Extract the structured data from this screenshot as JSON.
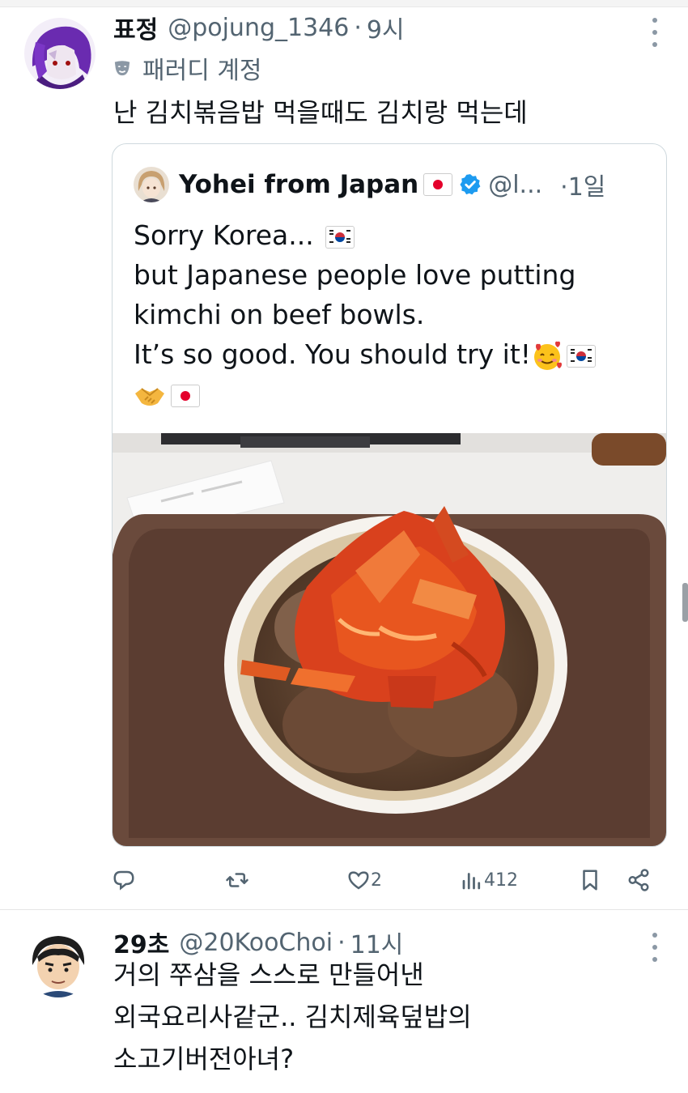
{
  "tweet1": {
    "display_name": "표정",
    "handle": "@pojung_1346",
    "sep": "·",
    "time": "9시",
    "label": "패러디 계정",
    "text": "난 김치볶음밥 먹을때도 김치랑 먹는데"
  },
  "quote": {
    "display_name": "Yohei from Japan",
    "handle": "@l...",
    "sep": "·",
    "time": "1일",
    "lines": [
      "Sorry Korea...",
      "but Japanese people love putting",
      "kimchi on beef bowls.",
      "It’s so good. You should try it!"
    ],
    "image_alt": "beef bowl topped with kimchi on a brown tray"
  },
  "actions": {
    "likes": "2",
    "views": "412"
  },
  "tweet2": {
    "display_name": "29초",
    "handle": "@20KooChoi",
    "sep": "·",
    "time": "11시",
    "lines": [
      "거의 쭈삼을 스스로 만들어낸",
      "외국요리사같군.. 김치제육덮밥의",
      "소고기버전아녀?"
    ]
  },
  "icons": {
    "reply": "reply-icon",
    "retweet": "retweet-icon",
    "like": "heart-icon",
    "views": "views-icon",
    "bookmark": "bookmark-icon",
    "share": "share-icon",
    "verified": "verified-badge-icon",
    "more": "more-options-icon",
    "parody": "parody-mask-icon"
  },
  "colors": {
    "text": "#0f1419",
    "secondary": "#536471",
    "verified": "#1d9bf0",
    "border": "#cfd9de"
  }
}
